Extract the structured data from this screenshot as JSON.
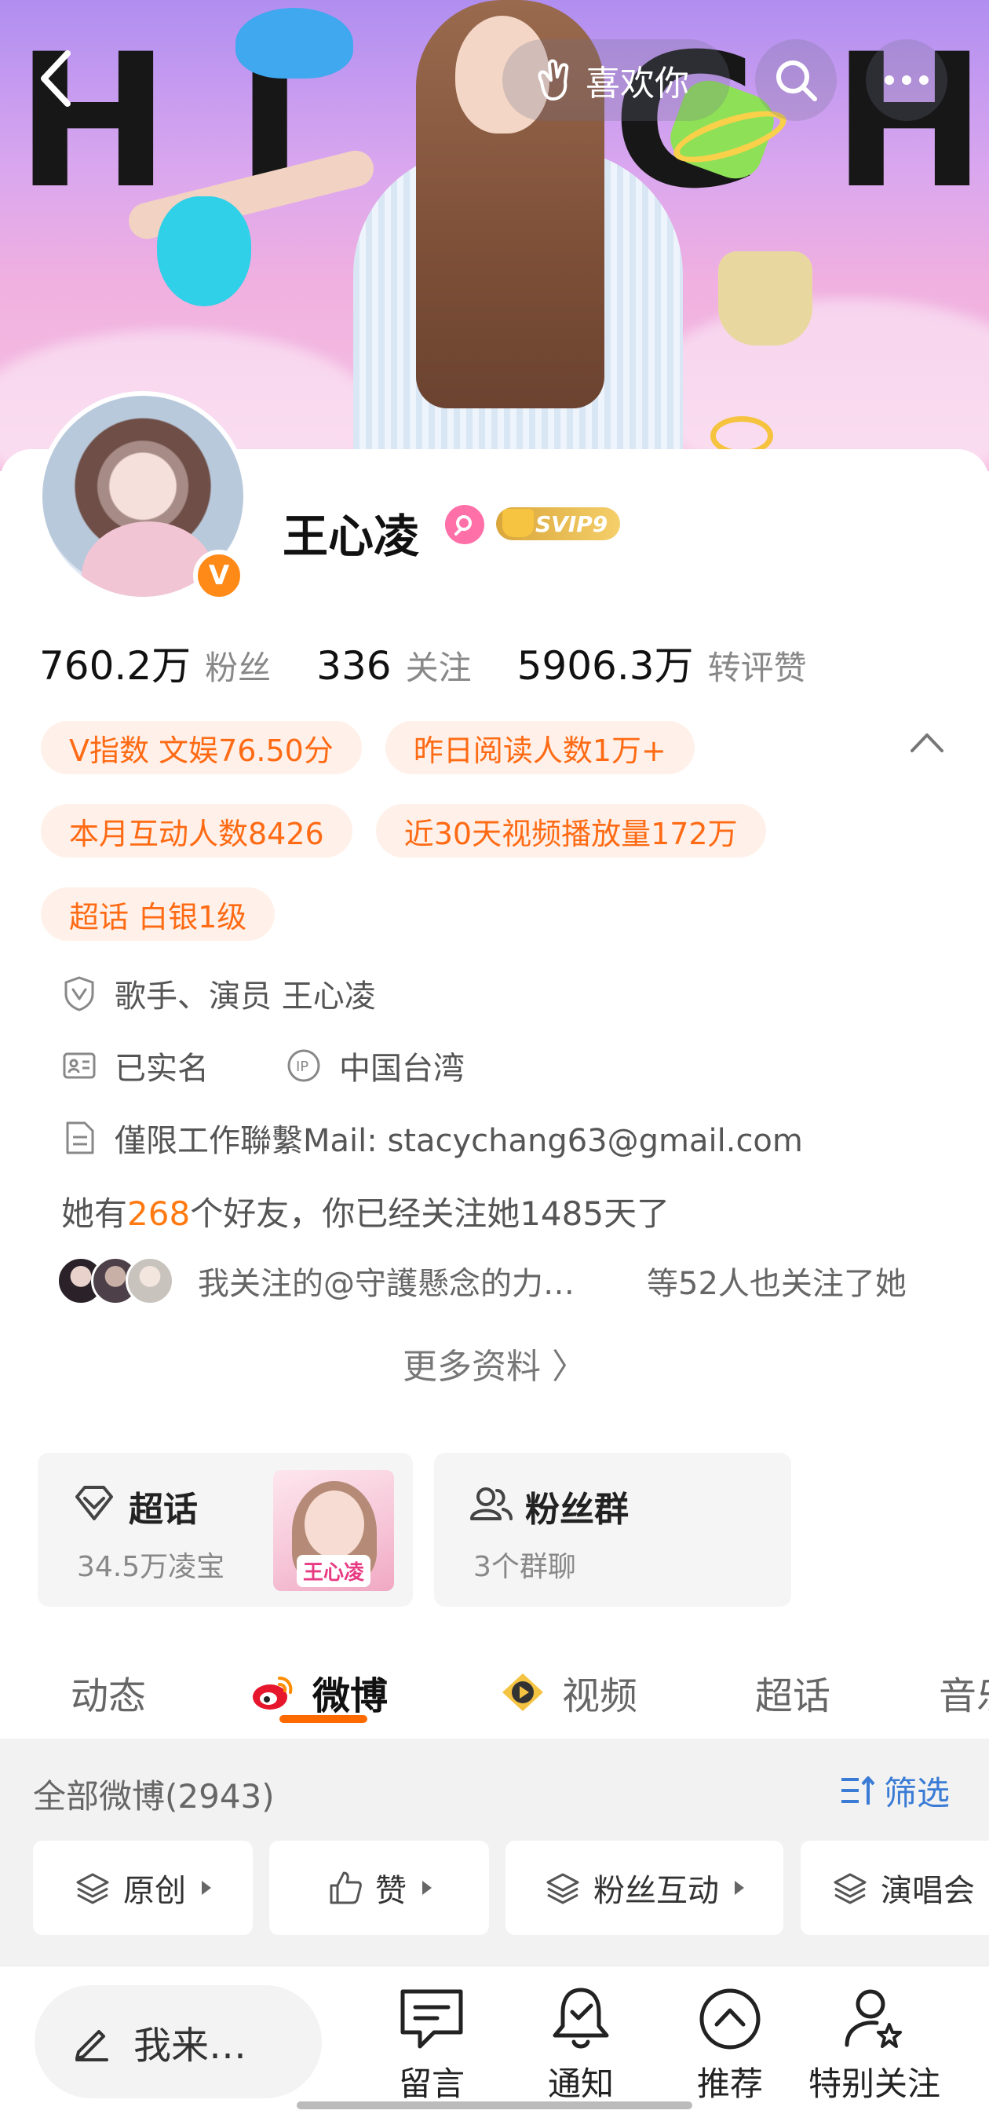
{
  "banner": {
    "letters": [
      "H",
      "I",
      "G",
      "H"
    ],
    "like_label": "喜欢你"
  },
  "profile": {
    "name": "王心凌",
    "vip_badge": "SVIP9",
    "verified_mark": "V",
    "stats": [
      {
        "value": "760.2万",
        "label": "粉丝"
      },
      {
        "value": "336",
        "label": "关注"
      },
      {
        "value": "5906.3万",
        "label": "转评赞"
      }
    ],
    "tags": [
      "V指数 文娱76.50分",
      "昨日阅读人数1万+",
      "本月互动人数8426",
      "近30天视频播放量172万",
      "超话 白银1级"
    ],
    "verification": "歌手、演员 王心凌",
    "real_name": "已实名",
    "ip_location": "中国台湾",
    "bio": "僅限工作聯繫Mail: stacychang63@gmail.com",
    "friends_prefix": "她有",
    "friends_count": "268",
    "friends_suffix": "个好友，你已经关注她1485天了",
    "mutual_text": "我关注的@守護懸念的力…",
    "mutual_suffix": "等52人也关注了她",
    "more_info": "更多资料 〉"
  },
  "shortcuts": {
    "supertopic": {
      "title": "超话",
      "sub": "34.5万凌宝",
      "thumb_label": "王心凌"
    },
    "fangroup": {
      "title": "粉丝群",
      "sub": "3个群聊"
    }
  },
  "tabs": [
    "动态",
    "微博",
    "视频",
    "超话",
    "音乐"
  ],
  "active_tab": "微博",
  "feed": {
    "count_label": "全部微博(2943)",
    "filter_label": "筛选",
    "pills": [
      "原创",
      "赞",
      "粉丝互动",
      "演唱会"
    ]
  },
  "bottom_bar": {
    "comment_placeholder": "我来…",
    "items": [
      "留言",
      "通知",
      "推荐",
      "特别关注"
    ]
  },
  "colors": {
    "accent": "#ff6a14",
    "tag_bg": "#fff1e9",
    "link_blue": "#3a7bd5",
    "tab_underline": "#ff6a00"
  }
}
